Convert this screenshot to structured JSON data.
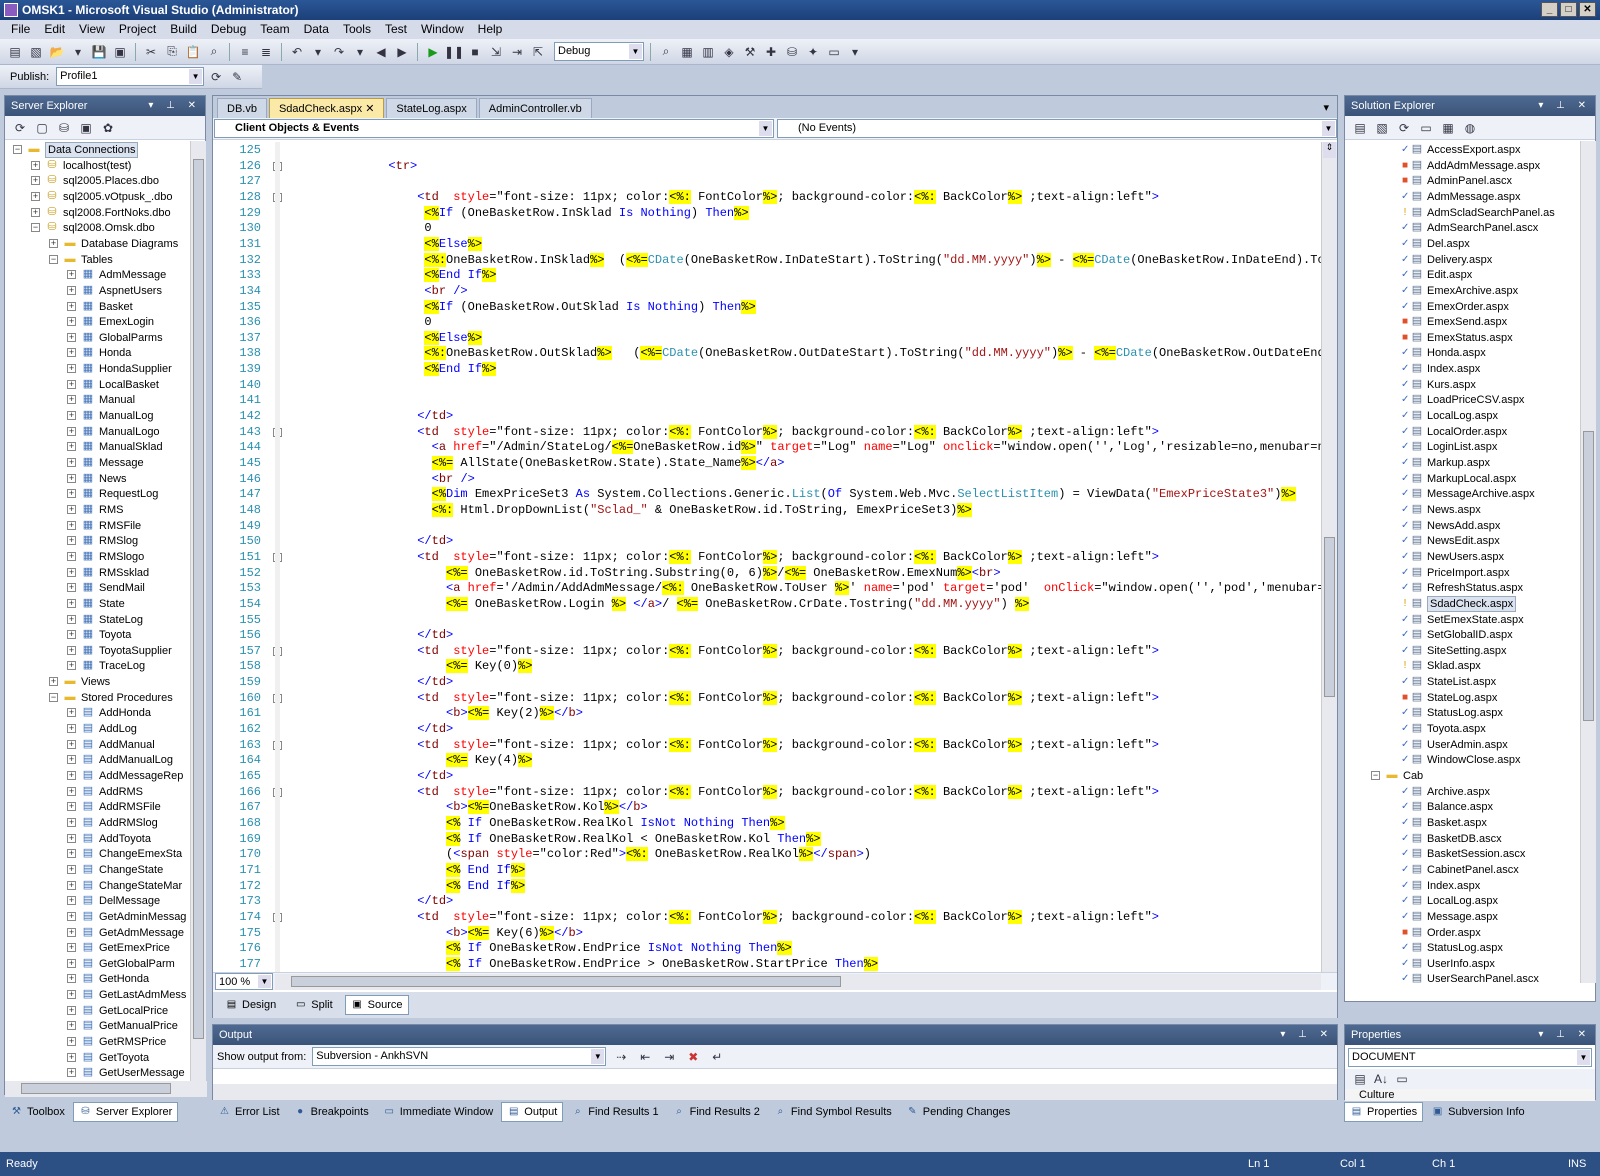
{
  "window": {
    "title": "OMSK1 - Microsoft Visual Studio (Administrator)"
  },
  "menu": [
    "File",
    "Edit",
    "View",
    "Project",
    "Build",
    "Debug",
    "Team",
    "Data",
    "Tools",
    "Test",
    "Window",
    "Help"
  ],
  "toolbar": {
    "config": "Debug",
    "publish_label": "Publish:",
    "publish_profile": "Profile1"
  },
  "server_explorer": {
    "title": "Server Explorer",
    "items": [
      {
        "label": "Data Connections",
        "level": 0,
        "exp": "-",
        "icon": "folder",
        "sel": true
      },
      {
        "label": "localhost(test)",
        "level": 1,
        "exp": "+",
        "icon": "db"
      },
      {
        "label": "sql2005.Places.dbo",
        "level": 1,
        "exp": "+",
        "icon": "db"
      },
      {
        "label": "sql2005.vOtpusk_.dbo",
        "level": 1,
        "exp": "+",
        "icon": "db"
      },
      {
        "label": "sql2008.FortNoks.dbo",
        "level": 1,
        "exp": "+",
        "icon": "db"
      },
      {
        "label": "sql2008.Omsk.dbo",
        "level": 1,
        "exp": "-",
        "icon": "db"
      },
      {
        "label": "Database Diagrams",
        "level": 2,
        "exp": "+",
        "icon": "folder"
      },
      {
        "label": "Tables",
        "level": 2,
        "exp": "-",
        "icon": "folder"
      },
      {
        "label": "AdmMessage",
        "level": 3,
        "exp": "+",
        "icon": "table"
      },
      {
        "label": "AspnetUsers",
        "level": 3,
        "exp": "+",
        "icon": "table"
      },
      {
        "label": "Basket",
        "level": 3,
        "exp": "+",
        "icon": "table"
      },
      {
        "label": "EmexLogin",
        "level": 3,
        "exp": "+",
        "icon": "table"
      },
      {
        "label": "GlobalParms",
        "level": 3,
        "exp": "+",
        "icon": "table"
      },
      {
        "label": "Honda",
        "level": 3,
        "exp": "+",
        "icon": "table"
      },
      {
        "label": "HondaSupplier",
        "level": 3,
        "exp": "+",
        "icon": "table"
      },
      {
        "label": "LocalBasket",
        "level": 3,
        "exp": "+",
        "icon": "table"
      },
      {
        "label": "Manual",
        "level": 3,
        "exp": "+",
        "icon": "table"
      },
      {
        "label": "ManualLog",
        "level": 3,
        "exp": "+",
        "icon": "table"
      },
      {
        "label": "ManualLogo",
        "level": 3,
        "exp": "+",
        "icon": "table"
      },
      {
        "label": "ManualSklad",
        "level": 3,
        "exp": "+",
        "icon": "table"
      },
      {
        "label": "Message",
        "level": 3,
        "exp": "+",
        "icon": "table"
      },
      {
        "label": "News",
        "level": 3,
        "exp": "+",
        "icon": "table"
      },
      {
        "label": "RequestLog",
        "level": 3,
        "exp": "+",
        "icon": "table"
      },
      {
        "label": "RMS",
        "level": 3,
        "exp": "+",
        "icon": "table"
      },
      {
        "label": "RMSFile",
        "level": 3,
        "exp": "+",
        "icon": "table"
      },
      {
        "label": "RMSlog",
        "level": 3,
        "exp": "+",
        "icon": "table"
      },
      {
        "label": "RMSlogo",
        "level": 3,
        "exp": "+",
        "icon": "table"
      },
      {
        "label": "RMSsklad",
        "level": 3,
        "exp": "+",
        "icon": "table"
      },
      {
        "label": "SendMail",
        "level": 3,
        "exp": "+",
        "icon": "table"
      },
      {
        "label": "State",
        "level": 3,
        "exp": "+",
        "icon": "table"
      },
      {
        "label": "StateLog",
        "level": 3,
        "exp": "+",
        "icon": "table"
      },
      {
        "label": "Toyota",
        "level": 3,
        "exp": "+",
        "icon": "table"
      },
      {
        "label": "ToyotaSupplier",
        "level": 3,
        "exp": "+",
        "icon": "table"
      },
      {
        "label": "TraceLog",
        "level": 3,
        "exp": "+",
        "icon": "table"
      },
      {
        "label": "Views",
        "level": 2,
        "exp": "+",
        "icon": "folder"
      },
      {
        "label": "Stored Procedures",
        "level": 2,
        "exp": "-",
        "icon": "folder"
      },
      {
        "label": "AddHonda",
        "level": 3,
        "exp": "+",
        "icon": "proc"
      },
      {
        "label": "AddLog",
        "level": 3,
        "exp": "+",
        "icon": "proc"
      },
      {
        "label": "AddManual",
        "level": 3,
        "exp": "+",
        "icon": "proc"
      },
      {
        "label": "AddManualLog",
        "level": 3,
        "exp": "+",
        "icon": "proc"
      },
      {
        "label": "AddMessageRep",
        "level": 3,
        "exp": "+",
        "icon": "proc"
      },
      {
        "label": "AddRMS",
        "level": 3,
        "exp": "+",
        "icon": "proc"
      },
      {
        "label": "AddRMSFile",
        "level": 3,
        "exp": "+",
        "icon": "proc"
      },
      {
        "label": "AddRMSlog",
        "level": 3,
        "exp": "+",
        "icon": "proc"
      },
      {
        "label": "AddToyota",
        "level": 3,
        "exp": "+",
        "icon": "proc"
      },
      {
        "label": "ChangeEmexSta",
        "level": 3,
        "exp": "+",
        "icon": "proc"
      },
      {
        "label": "ChangeState",
        "level": 3,
        "exp": "+",
        "icon": "proc"
      },
      {
        "label": "ChangeStateMar",
        "level": 3,
        "exp": "+",
        "icon": "proc"
      },
      {
        "label": "DelMessage",
        "level": 3,
        "exp": "+",
        "icon": "proc"
      },
      {
        "label": "GetAdminMessag",
        "level": 3,
        "exp": "+",
        "icon": "proc"
      },
      {
        "label": "GetAdmMessage",
        "level": 3,
        "exp": "+",
        "icon": "proc"
      },
      {
        "label": "GetEmexPrice",
        "level": 3,
        "exp": "+",
        "icon": "proc"
      },
      {
        "label": "GetGlobalParm",
        "level": 3,
        "exp": "+",
        "icon": "proc"
      },
      {
        "label": "GetHonda",
        "level": 3,
        "exp": "+",
        "icon": "proc"
      },
      {
        "label": "GetLastAdmMess",
        "level": 3,
        "exp": "+",
        "icon": "proc"
      },
      {
        "label": "GetLocalPrice",
        "level": 3,
        "exp": "+",
        "icon": "proc"
      },
      {
        "label": "GetManualPrice",
        "level": 3,
        "exp": "+",
        "icon": "proc"
      },
      {
        "label": "GetRMSPrice",
        "level": 3,
        "exp": "+",
        "icon": "proc"
      },
      {
        "label": "GetToyota",
        "level": 3,
        "exp": "+",
        "icon": "proc"
      },
      {
        "label": "GetUserMessage",
        "level": 3,
        "exp": "+",
        "icon": "proc"
      }
    ]
  },
  "editor": {
    "tabs": [
      {
        "label": "DB.vb",
        "active": false
      },
      {
        "label": "SdadCheck.aspx",
        "active": true
      },
      {
        "label": "StateLog.aspx",
        "active": false
      },
      {
        "label": "AdminController.vb",
        "active": false
      }
    ],
    "objects_dropdown": "Client Objects & Events",
    "events_dropdown": "(No Events)",
    "zoom": "100 %",
    "view_tabs": [
      "Design",
      "Split",
      "Source"
    ],
    "lines": [
      [
        125,
        ""
      ],
      [
        126,
        "            <tr>"
      ],
      [
        127,
        ""
      ],
      [
        128,
        "                <td  style=\"font-size: 11px; color:<%: FontColor%>; background-color:<%: BackColor%> ;text-align:left\">"
      ],
      [
        129,
        "                 <%If (OneBasketRow.InSklad Is Nothing) Then%>"
      ],
      [
        130,
        "                 0"
      ],
      [
        131,
        "                 <%Else%>"
      ],
      [
        132,
        "                 <%:OneBasketRow.InSklad%>  (<%=CDate(OneBasketRow.InDateStart).ToString(\"dd.MM.yyyy\")%> - <%=CDate(OneBasketRow.InDateEnd).ToString(\"dd"
      ],
      [
        133,
        "                 <%End If%>"
      ],
      [
        134,
        "                 <br />"
      ],
      [
        135,
        "                 <%If (OneBasketRow.OutSklad Is Nothing) Then%>"
      ],
      [
        136,
        "                 0"
      ],
      [
        137,
        "                 <%Else%>"
      ],
      [
        138,
        "                 <%:OneBasketRow.OutSklad%>   (<%=CDate(OneBasketRow.OutDateStart).ToString(\"dd.MM.yyyy\")%> - <%=CDate(OneBasketRow.OutDateEnd).ToString"
      ],
      [
        139,
        "                 <%End If%>"
      ],
      [
        140,
        ""
      ],
      [
        141,
        ""
      ],
      [
        142,
        "                </td>"
      ],
      [
        143,
        "                <td  style=\"font-size: 11px; color:<%: FontColor%>; background-color:<%: BackColor%> ;text-align:left\">"
      ],
      [
        144,
        "                  <a href=\"/Admin/StateLog/<%=OneBasketRow.id%>\" target=\"Log\" name=\"Log\" onclick=\"window.open('','Log','resizable=no,menubar=no,scroll"
      ],
      [
        145,
        "                  <%= AllState(OneBasketRow.State).State_Name%></a>"
      ],
      [
        146,
        "                  <br />"
      ],
      [
        147,
        "                  <%Dim EmexPriceSet3 As System.Collections.Generic.List(Of System.Web.Mvc.SelectListItem) = ViewData(\"EmexPriceState3\")%>"
      ],
      [
        148,
        "                  <%: Html.DropDownList(\"Sclad_\" & OneBasketRow.id.ToString, EmexPriceSet3)%>"
      ],
      [
        149,
        ""
      ],
      [
        150,
        "                </td>"
      ],
      [
        151,
        "                <td  style=\"font-size: 11px; color:<%: FontColor%>; background-color:<%: BackColor%> ;text-align:left\">"
      ],
      [
        152,
        "                    <%= OneBasketRow.id.ToString.Substring(0, 6)%>/<%= OneBasketRow.EmexNum%><br>"
      ],
      [
        153,
        "                    <a href='/Admin/AddAdmMessage/<%: OneBasketRow.ToUser %>' name='pod' target='pod'  onClick=\"window.open('','pod','menubar=no,resiza"
      ],
      [
        154,
        "                    <%= OneBasketRow.Login %> </a>/ <%= OneBasketRow.CrDate.Tostring(\"dd.MM.yyyy\") %>"
      ],
      [
        155,
        ""
      ],
      [
        156,
        "                </td>"
      ],
      [
        157,
        "                <td  style=\"font-size: 11px; color:<%: FontColor%>; background-color:<%: BackColor%> ;text-align:left\">"
      ],
      [
        158,
        "                    <%= Key(0)%>"
      ],
      [
        159,
        "                </td>"
      ],
      [
        160,
        "                <td  style=\"font-size: 11px; color:<%: FontColor%>; background-color:<%: BackColor%> ;text-align:left\">"
      ],
      [
        161,
        "                    <b><%= Key(2)%></b>"
      ],
      [
        162,
        "                </td>"
      ],
      [
        163,
        "                <td  style=\"font-size: 11px; color:<%: FontColor%>; background-color:<%: BackColor%> ;text-align:left\">"
      ],
      [
        164,
        "                    <%= Key(4)%>"
      ],
      [
        165,
        "                </td>"
      ],
      [
        166,
        "                <td  style=\"font-size: 11px; color:<%: FontColor%>; background-color:<%: BackColor%> ;text-align:left\">"
      ],
      [
        167,
        "                    <b><%=OneBasketRow.Kol%></b>"
      ],
      [
        168,
        "                    <% If OneBasketRow.RealKol IsNot Nothing Then%>"
      ],
      [
        169,
        "                    <% If OneBasketRow.RealKol < OneBasketRow.Kol Then%>"
      ],
      [
        170,
        "                    (<span style=\"color:Red\"><%: OneBasketRow.RealKol%></span>)"
      ],
      [
        171,
        "                    <% End If%>"
      ],
      [
        172,
        "                    <% End If%>"
      ],
      [
        173,
        "                </td>"
      ],
      [
        174,
        "                <td  style=\"font-size: 11px; color:<%: FontColor%>; background-color:<%: BackColor%> ;text-align:left\">"
      ],
      [
        175,
        "                    <b><%= Key(6)%></b>"
      ],
      [
        176,
        "                    <% If OneBasketRow.EndPrice IsNot Nothing Then%>"
      ],
      [
        177,
        "                    <% If OneBasketRow.EndPrice > OneBasketRow.StartPrice Then%>"
      ]
    ]
  },
  "output": {
    "title": "Output",
    "show_label": "Show output from:",
    "source": "Subversion - AnkhSVN"
  },
  "bottom_tabs_left": [
    "Toolbox",
    "Server Explorer"
  ],
  "bottom_tabs_center": [
    "Error List",
    "Breakpoints",
    "Immediate Window",
    "Output",
    "Find Results 1",
    "Find Results 2",
    "Find Symbol Results",
    "Pending Changes"
  ],
  "bottom_tabs_right": [
    "Properties",
    "Subversion Info"
  ],
  "solution_explorer": {
    "title": "Solution Explorer",
    "items": [
      {
        "label": "AccessExport.aspx",
        "level": 2,
        "st": "ok"
      },
      {
        "label": "AddAdmMessage.aspx",
        "level": 2,
        "st": "mod"
      },
      {
        "label": "AdminPanel.ascx",
        "level": 2,
        "st": "mod"
      },
      {
        "label": "AdmMessage.aspx",
        "level": 2,
        "st": "ok"
      },
      {
        "label": "AdmScladSearchPanel.as",
        "level": 2,
        "st": "warn"
      },
      {
        "label": "AdmSearchPanel.ascx",
        "level": 2,
        "st": "ok"
      },
      {
        "label": "Del.aspx",
        "level": 2,
        "st": "ok"
      },
      {
        "label": "Delivery.aspx",
        "level": 2,
        "st": "ok"
      },
      {
        "label": "Edit.aspx",
        "level": 2,
        "st": "ok"
      },
      {
        "label": "EmexArchive.aspx",
        "level": 2,
        "st": "ok"
      },
      {
        "label": "EmexOrder.aspx",
        "level": 2,
        "st": "ok"
      },
      {
        "label": "EmexSend.aspx",
        "level": 2,
        "st": "mod"
      },
      {
        "label": "EmexStatus.aspx",
        "level": 2,
        "st": "mod"
      },
      {
        "label": "Honda.aspx",
        "level": 2,
        "st": "ok"
      },
      {
        "label": "Index.aspx",
        "level": 2,
        "st": "ok"
      },
      {
        "label": "Kurs.aspx",
        "level": 2,
        "st": "ok"
      },
      {
        "label": "LoadPriceCSV.aspx",
        "level": 2,
        "st": "ok"
      },
      {
        "label": "LocalLog.aspx",
        "level": 2,
        "st": "ok"
      },
      {
        "label": "LocalOrder.aspx",
        "level": 2,
        "st": "ok"
      },
      {
        "label": "LoginList.aspx",
        "level": 2,
        "st": "ok"
      },
      {
        "label": "Markup.aspx",
        "level": 2,
        "st": "ok"
      },
      {
        "label": "MarkupLocal.aspx",
        "level": 2,
        "st": "ok"
      },
      {
        "label": "MessageArchive.aspx",
        "level": 2,
        "st": "ok"
      },
      {
        "label": "News.aspx",
        "level": 2,
        "st": "ok"
      },
      {
        "label": "NewsAdd.aspx",
        "level": 2,
        "st": "ok"
      },
      {
        "label": "NewsEdit.aspx",
        "level": 2,
        "st": "ok"
      },
      {
        "label": "NewUsers.aspx",
        "level": 2,
        "st": "ok"
      },
      {
        "label": "PriceImport.aspx",
        "level": 2,
        "st": "ok"
      },
      {
        "label": "RefreshStatus.aspx",
        "level": 2,
        "st": "ok"
      },
      {
        "label": "SdadCheck.aspx",
        "level": 2,
        "st": "warn",
        "sel": true
      },
      {
        "label": "SetEmexState.aspx",
        "level": 2,
        "st": "ok"
      },
      {
        "label": "SetGlobalID.aspx",
        "level": 2,
        "st": "ok"
      },
      {
        "label": "SiteSetting.aspx",
        "level": 2,
        "st": "ok"
      },
      {
        "label": "Sklad.aspx",
        "level": 2,
        "st": "warn"
      },
      {
        "label": "StateList.aspx",
        "level": 2,
        "st": "ok"
      },
      {
        "label": "StateLog.aspx",
        "level": 2,
        "st": "mod"
      },
      {
        "label": "StatusLog.aspx",
        "level": 2,
        "st": "ok"
      },
      {
        "label": "Toyota.aspx",
        "level": 2,
        "st": "ok"
      },
      {
        "label": "UserAdmin.aspx",
        "level": 2,
        "st": "ok"
      },
      {
        "label": "WindowClose.aspx",
        "level": 2,
        "st": "ok"
      },
      {
        "label": "Cab",
        "level": 1,
        "st": "folder"
      },
      {
        "label": "Archive.aspx",
        "level": 2,
        "st": "ok"
      },
      {
        "label": "Balance.aspx",
        "level": 2,
        "st": "ok"
      },
      {
        "label": "Basket.aspx",
        "level": 2,
        "st": "ok"
      },
      {
        "label": "BasketDB.ascx",
        "level": 2,
        "st": "ok"
      },
      {
        "label": "BasketSession.ascx",
        "level": 2,
        "st": "ok"
      },
      {
        "label": "CabinetPanel.ascx",
        "level": 2,
        "st": "ok"
      },
      {
        "label": "Index.aspx",
        "level": 2,
        "st": "ok"
      },
      {
        "label": "LocalLog.aspx",
        "level": 2,
        "st": "ok"
      },
      {
        "label": "Message.aspx",
        "level": 2,
        "st": "ok"
      },
      {
        "label": "Order.aspx",
        "level": 2,
        "st": "mod"
      },
      {
        "label": "StatusLog.aspx",
        "level": 2,
        "st": "ok"
      },
      {
        "label": "UserInfo.aspx",
        "level": 2,
        "st": "ok"
      },
      {
        "label": "UserSearchPanel.ascx",
        "level": 2,
        "st": "ok"
      }
    ]
  },
  "properties": {
    "title": "Properties",
    "object": "DOCUMENT",
    "first_property": "Culture"
  },
  "status": {
    "ready": "Ready",
    "ln": "Ln 1",
    "col": "Col 1",
    "ch": "Ch 1",
    "mode": "INS"
  }
}
